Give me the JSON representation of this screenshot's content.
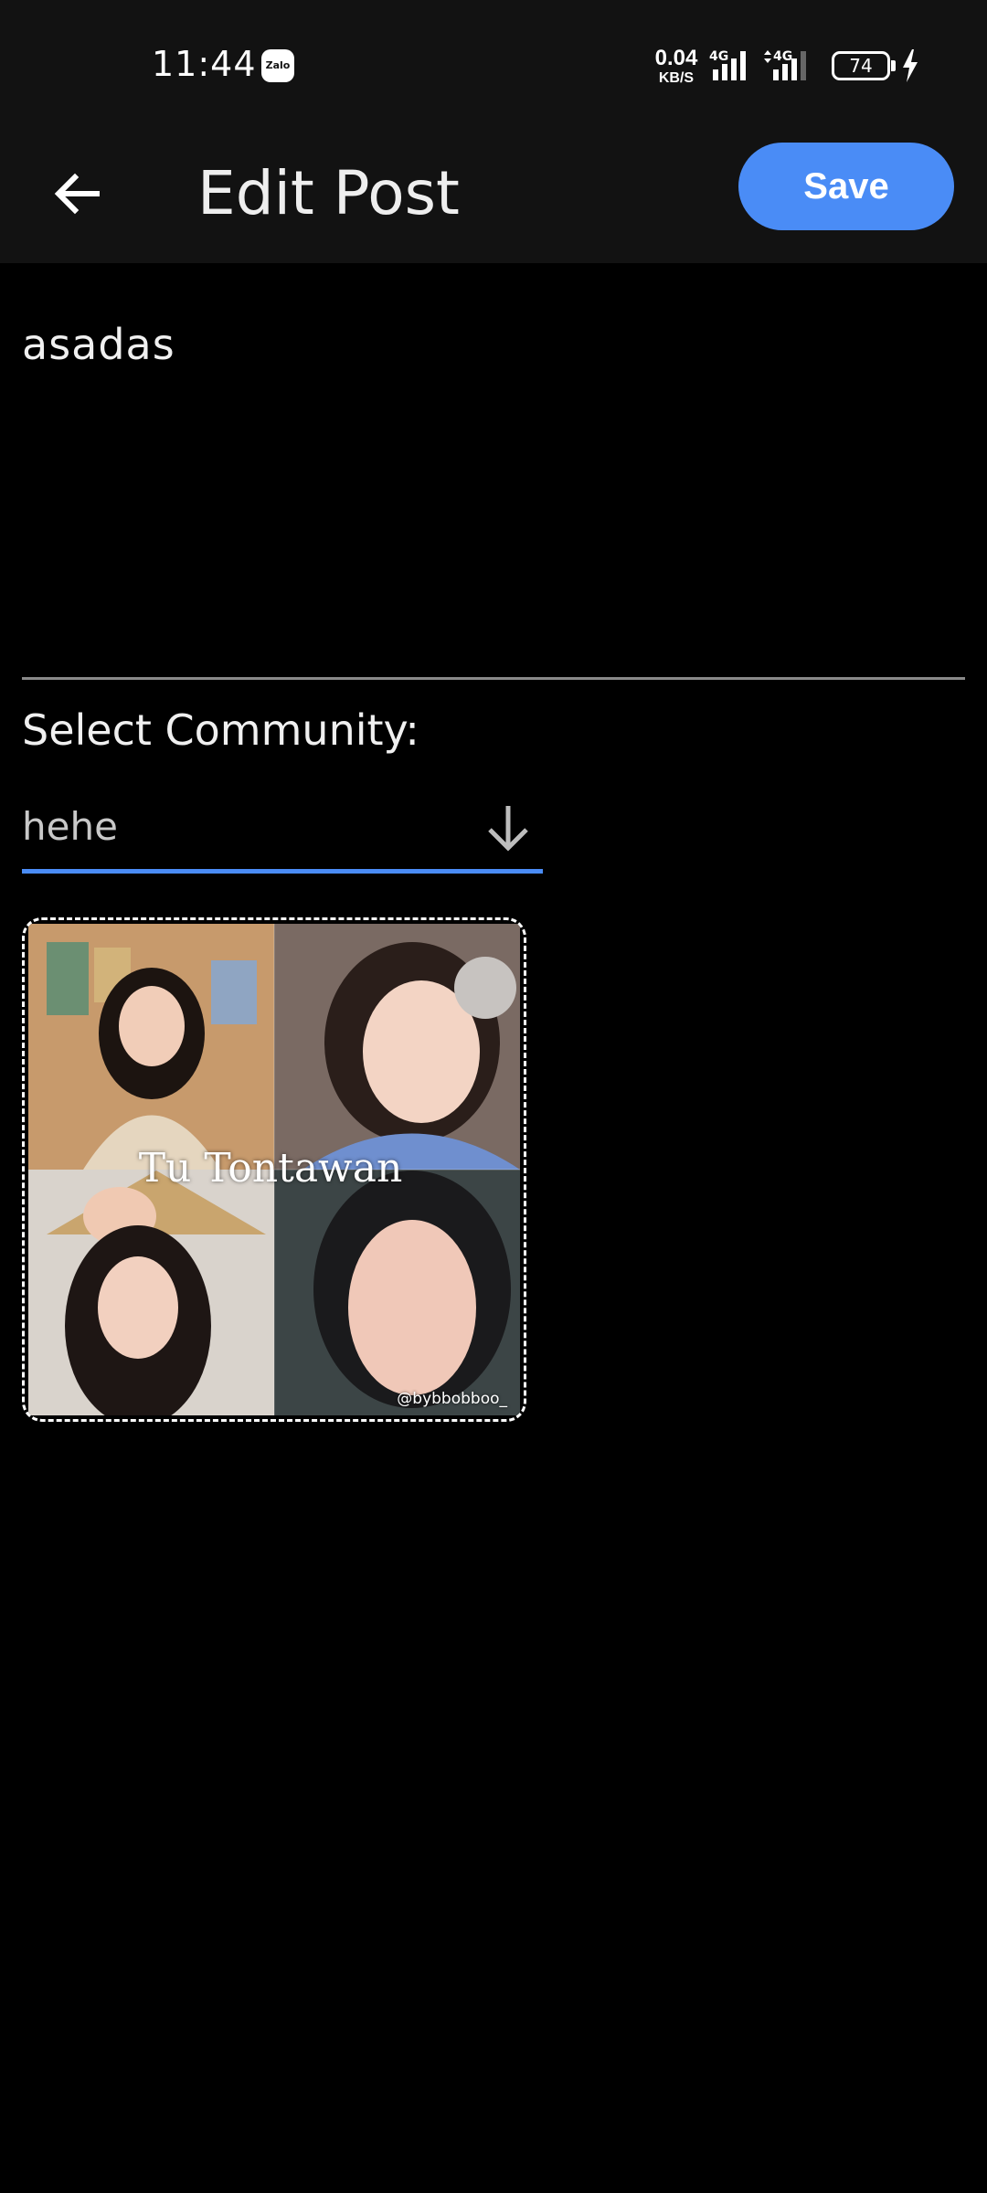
{
  "status_bar": {
    "time": "11:44",
    "app_notification": "Zalo",
    "net_speed_value": "0.04",
    "net_speed_unit": "KB/S",
    "network_1": "4G",
    "network_2": "4G",
    "battery": "74"
  },
  "app_bar": {
    "back_icon": "arrow-left",
    "title": "Edit Post",
    "save_label": "Save"
  },
  "post": {
    "text": "asadas"
  },
  "community": {
    "label": "Select Community:",
    "selected": "hehe",
    "dropdown_icon": "arrow-down"
  },
  "image": {
    "caption": "Tu Tontawan",
    "watermark": "@bybbobboo_"
  },
  "colors": {
    "accent": "#4a8cf6",
    "background": "#000000",
    "bar": "#121212"
  }
}
